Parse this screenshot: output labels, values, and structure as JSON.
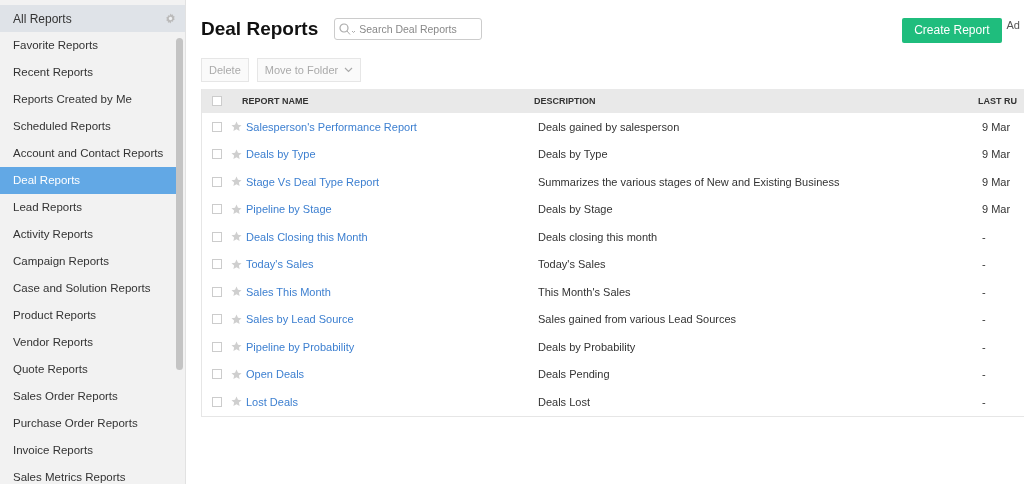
{
  "sidebar": {
    "header": "All Reports",
    "items": [
      {
        "label": "Favorite Reports",
        "selected": false
      },
      {
        "label": "Recent Reports",
        "selected": false
      },
      {
        "label": "Reports Created by Me",
        "selected": false
      },
      {
        "label": "Scheduled Reports",
        "selected": false
      },
      {
        "label": "Account and Contact Reports",
        "selected": false
      },
      {
        "label": "Deal Reports",
        "selected": true
      },
      {
        "label": "Lead Reports",
        "selected": false
      },
      {
        "label": "Activity Reports",
        "selected": false
      },
      {
        "label": "Campaign Reports",
        "selected": false
      },
      {
        "label": "Case and Solution Reports",
        "selected": false
      },
      {
        "label": "Product Reports",
        "selected": false
      },
      {
        "label": "Vendor Reports",
        "selected": false
      },
      {
        "label": "Quote Reports",
        "selected": false
      },
      {
        "label": "Sales Order Reports",
        "selected": false
      },
      {
        "label": "Purchase Order Reports",
        "selected": false
      },
      {
        "label": "Invoice Reports",
        "selected": false
      },
      {
        "label": "Sales Metrics Reports",
        "selected": false
      }
    ]
  },
  "page": {
    "title": "Deal Reports",
    "search": {
      "placeholder": "Search Deal Reports"
    },
    "create_button": "Create Report",
    "cut_link": "Ad"
  },
  "toolbar": [
    {
      "label": "Delete",
      "disabled": true,
      "dropdown": false
    },
    {
      "label": "Move to Folder",
      "disabled": true,
      "dropdown": true
    }
  ],
  "table": {
    "select_all": {
      "checked": false
    },
    "columns": [
      "REPORT NAME",
      "DESCRIPTION",
      "LAST RU"
    ],
    "rows": [
      {
        "checked": false,
        "favorite": false,
        "name": "Salesperson's Performance Report",
        "description": "Deals gained by salesperson",
        "last_run": "9 Mar"
      },
      {
        "checked": false,
        "favorite": false,
        "name": "Deals by Type",
        "description": "Deals by Type",
        "last_run": "9 Mar"
      },
      {
        "checked": false,
        "favorite": false,
        "name": "Stage Vs Deal Type Report",
        "description": "Summarizes the various stages of New and Existing Business",
        "last_run": "9 Mar"
      },
      {
        "checked": false,
        "favorite": false,
        "name": "Pipeline by Stage",
        "description": "Deals by Stage",
        "last_run": "9 Mar"
      },
      {
        "checked": false,
        "favorite": false,
        "name": "Deals Closing this Month",
        "description": "Deals closing this month",
        "last_run": "-"
      },
      {
        "checked": false,
        "favorite": false,
        "name": "Today's Sales",
        "description": "Today's Sales",
        "last_run": "-"
      },
      {
        "checked": false,
        "favorite": false,
        "name": "Sales This Month",
        "description": "This Month's Sales",
        "last_run": "-"
      },
      {
        "checked": false,
        "favorite": false,
        "name": "Sales by Lead Source",
        "description": "Sales gained from various Lead Sources",
        "last_run": "-"
      },
      {
        "checked": false,
        "favorite": false,
        "name": "Pipeline by Probability",
        "description": "Deals by Probability",
        "last_run": "-"
      },
      {
        "checked": false,
        "favorite": false,
        "name": "Open Deals",
        "description": "Deals Pending",
        "last_run": "-"
      },
      {
        "checked": false,
        "favorite": false,
        "name": "Lost Deals",
        "description": "Deals Lost",
        "last_run": "-"
      }
    ]
  }
}
